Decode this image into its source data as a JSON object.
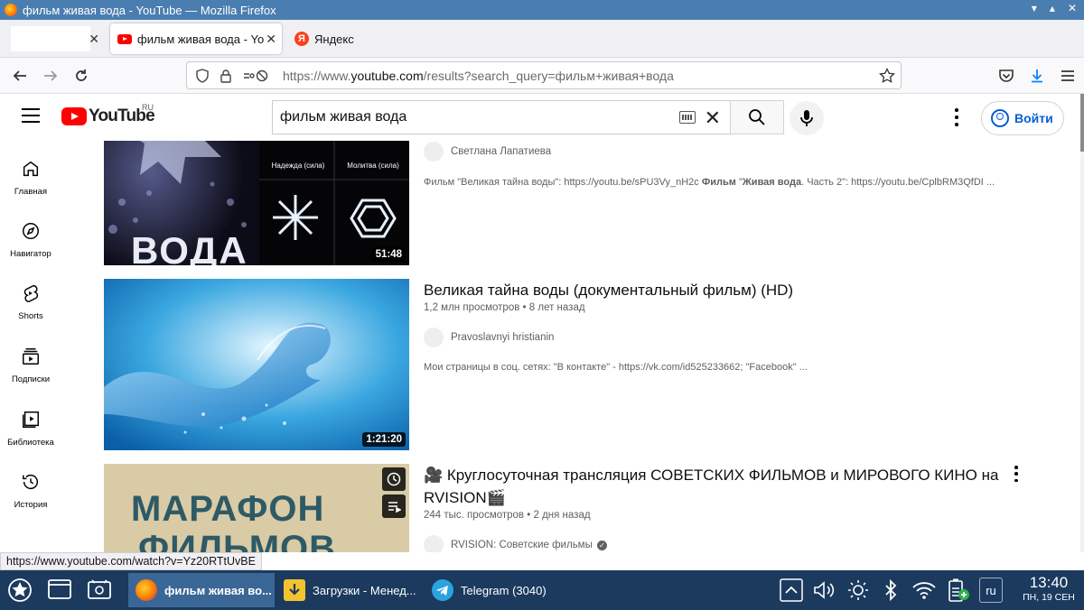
{
  "window": {
    "title": "фильм живая вода - YouTube — Mozilla Firefox"
  },
  "tabs": [
    {
      "label": ""
    },
    {
      "label": "фильм живая вода - YouTube"
    },
    {
      "label": "Яндекс"
    }
  ],
  "url": {
    "prefix": "https://www.",
    "host": "youtube.com",
    "path": "/results?search_query=фильм+живая+вода"
  },
  "youtube": {
    "logo": "YouTube",
    "region": "RU",
    "search_value": "фильм живая вода",
    "signin": "Войти"
  },
  "sidenav": [
    {
      "label": "Главная",
      "icon": "home-icon"
    },
    {
      "label": "Навигатор",
      "icon": "compass-icon"
    },
    {
      "label": "Shorts",
      "icon": "shorts-icon"
    },
    {
      "label": "Подписки",
      "icon": "subscriptions-icon"
    },
    {
      "label": "Библиотека",
      "icon": "library-icon"
    },
    {
      "label": "История",
      "icon": "history-icon"
    }
  ],
  "videos": [
    {
      "channel": "Светлана Лапатиева",
      "desc_a": "Фильм \"Великая тайна воды\": https://youtu.be/sPU3Vy_nH2c ",
      "desc_b": "Фильм",
      "desc_c": " \"",
      "desc_d": "Живая вода",
      "desc_e": ". Часть 2\": https://youtu.be/CplbRM3QfDI ...",
      "duration": "51:48",
      "thumb_text": "ВОДА",
      "thumb_cap1": "Надежда (сила)",
      "thumb_cap2": "Молитва (сила)"
    },
    {
      "title": "Великая тайна воды (документальный фильм) (HD)",
      "views": "1,2 млн просмотров",
      "age": "8 лет назад",
      "channel": "Pravoslavnyi hristianin",
      "desc": "Мои страницы в соц. сетях: \"В контакте\" - https://vk.com/id525233662; \"Facebook\" ...",
      "duration": "1:21:20"
    },
    {
      "title": "🎥 Круглосуточная трансляция СОВЕТСКИХ ФИЛЬМОВ и МИРОВОГО КИНО на RVISION🎬",
      "views": "244 тыс. просмотров",
      "age": "2 дня назад",
      "channel": "RVISION: Советские фильмы",
      "thumb_line1": "МАРАФОН",
      "thumb_line2": "ФИЛЬМОВ"
    }
  ],
  "meta_sep": "•",
  "status_link": "https://www.youtube.com/watch?v=Yz20RTtUvBE",
  "taskbar": {
    "tasks": [
      {
        "label": "фильм живая во..."
      },
      {
        "label": "Загрузки - Менед..."
      },
      {
        "label": "Telegram (3040)"
      }
    ],
    "lang": "ru",
    "time": "13:40",
    "date": "пн, 19 сен"
  }
}
